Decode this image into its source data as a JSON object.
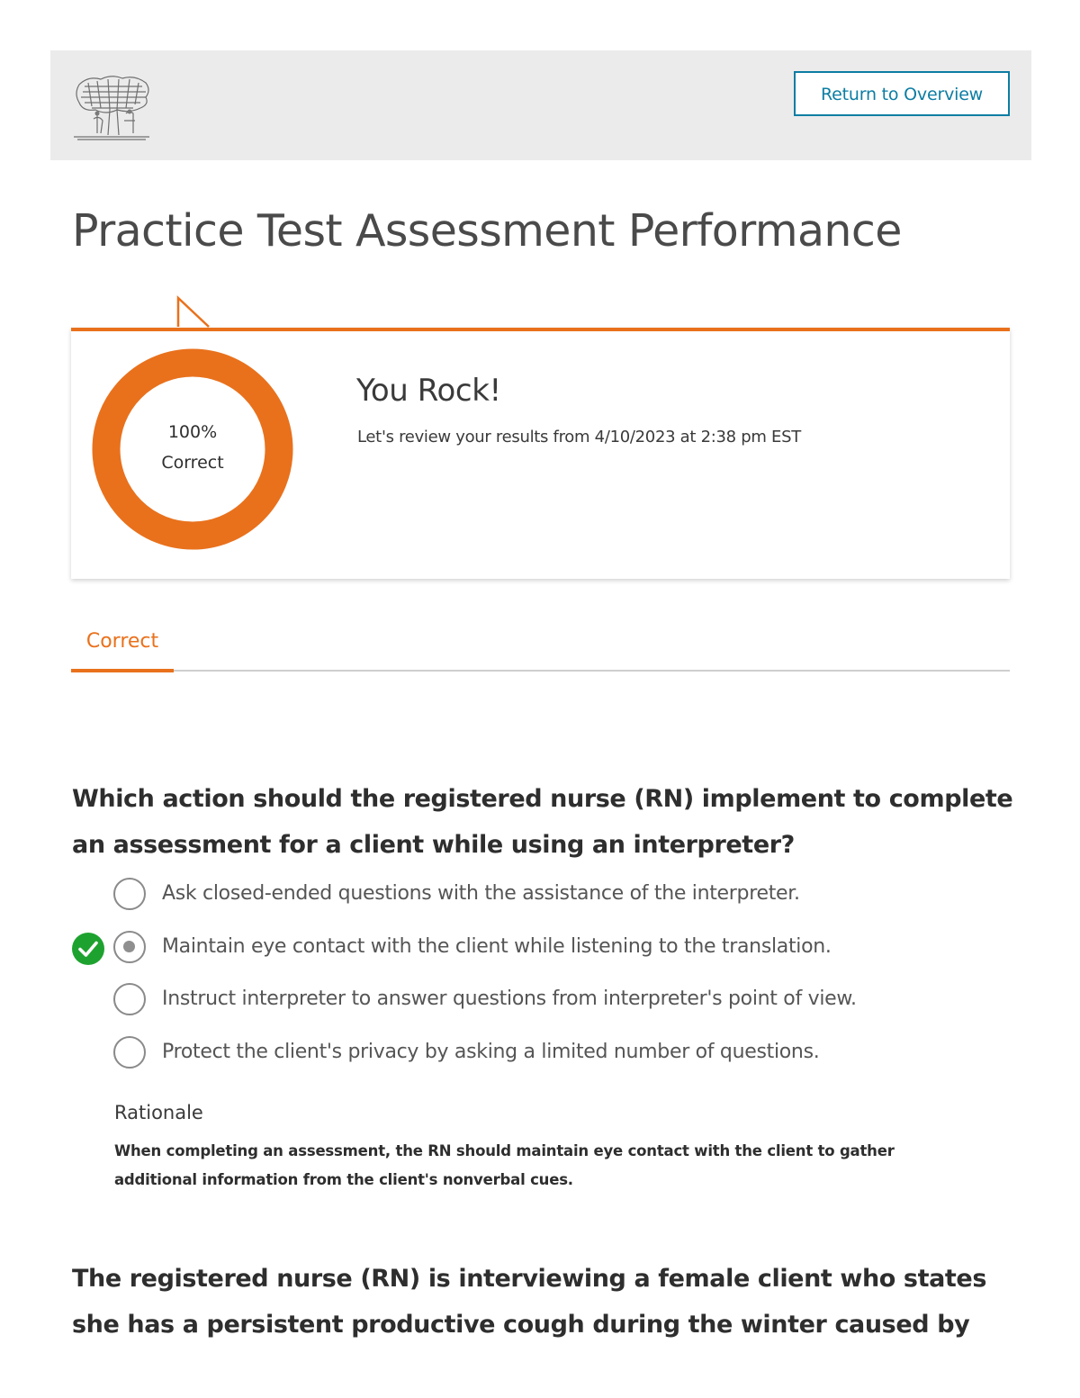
{
  "header": {
    "logo": "elsevier-tree-logo",
    "return_button_label": "Return to Overview"
  },
  "page": {
    "title": "Practice Test Assessment Performance"
  },
  "result": {
    "percent_label": "100%",
    "correct_label": "Correct",
    "percent_value": 100,
    "headline": "You Rock!",
    "review_text": "Let's review your results from 4/10/2023 at 2:38 pm EST",
    "accent_color": "#e9711c"
  },
  "tabs": {
    "items": [
      {
        "label": "Correct",
        "active": true
      }
    ]
  },
  "questions": [
    {
      "text": "Which action should the registered nurse (RN) implement to complete an assessment for a client while using an interpreter?",
      "options": [
        {
          "label": "Ask closed-ended questions with the assistance of the interpreter.",
          "selected": false
        },
        {
          "label": "Maintain eye contact with the client while listening to the translation.",
          "selected": true,
          "correct": true
        },
        {
          "label": "Instruct interpreter to answer questions from interpreter's point of view.",
          "selected": false
        },
        {
          "label": "Protect the client's privacy by asking a limited number of questions.",
          "selected": false
        }
      ],
      "rationale_heading": "Rationale",
      "rationale": "When completing an assessment, the RN should maintain eye contact with the client to gather additional information from the client's nonverbal cues."
    },
    {
      "text": "The registered nurse (RN) is interviewing a female client who states she has a persistent productive cough during the winter caused by"
    }
  ],
  "colors": {
    "correct_green": "#1ea22f",
    "link_blue": "#0c7da3"
  }
}
